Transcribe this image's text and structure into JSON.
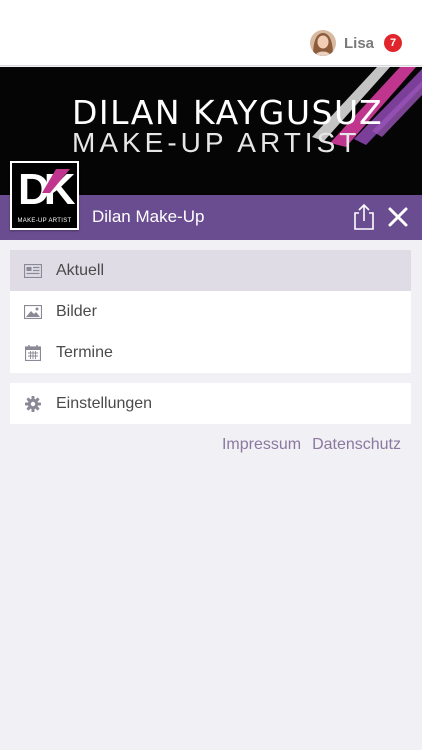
{
  "header": {
    "user_name": "Lisa",
    "notification_count": "7"
  },
  "banner": {
    "title": "DILAN KAYGUSUZ",
    "subtitle": "MAKE-UP ARTIST"
  },
  "app_bar": {
    "title": "Dilan Make-Up"
  },
  "logo": {
    "letters": "DK",
    "tagline": "MAKE-UP ARTIST"
  },
  "menu": {
    "items": [
      {
        "label": "Aktuell",
        "icon": "newspaper-icon",
        "active": true
      },
      {
        "label": "Bilder",
        "icon": "image-icon",
        "active": false
      },
      {
        "label": "Termine",
        "icon": "calendar-icon",
        "active": false
      }
    ],
    "settings": {
      "label": "Einstellungen",
      "icon": "gear-icon"
    }
  },
  "footer_links": {
    "impressum": "Impressum",
    "datenschutz": "Datenschutz"
  },
  "colors": {
    "accent": "#6a4d91",
    "badge": "#e0262c",
    "link": "#8c789f"
  }
}
